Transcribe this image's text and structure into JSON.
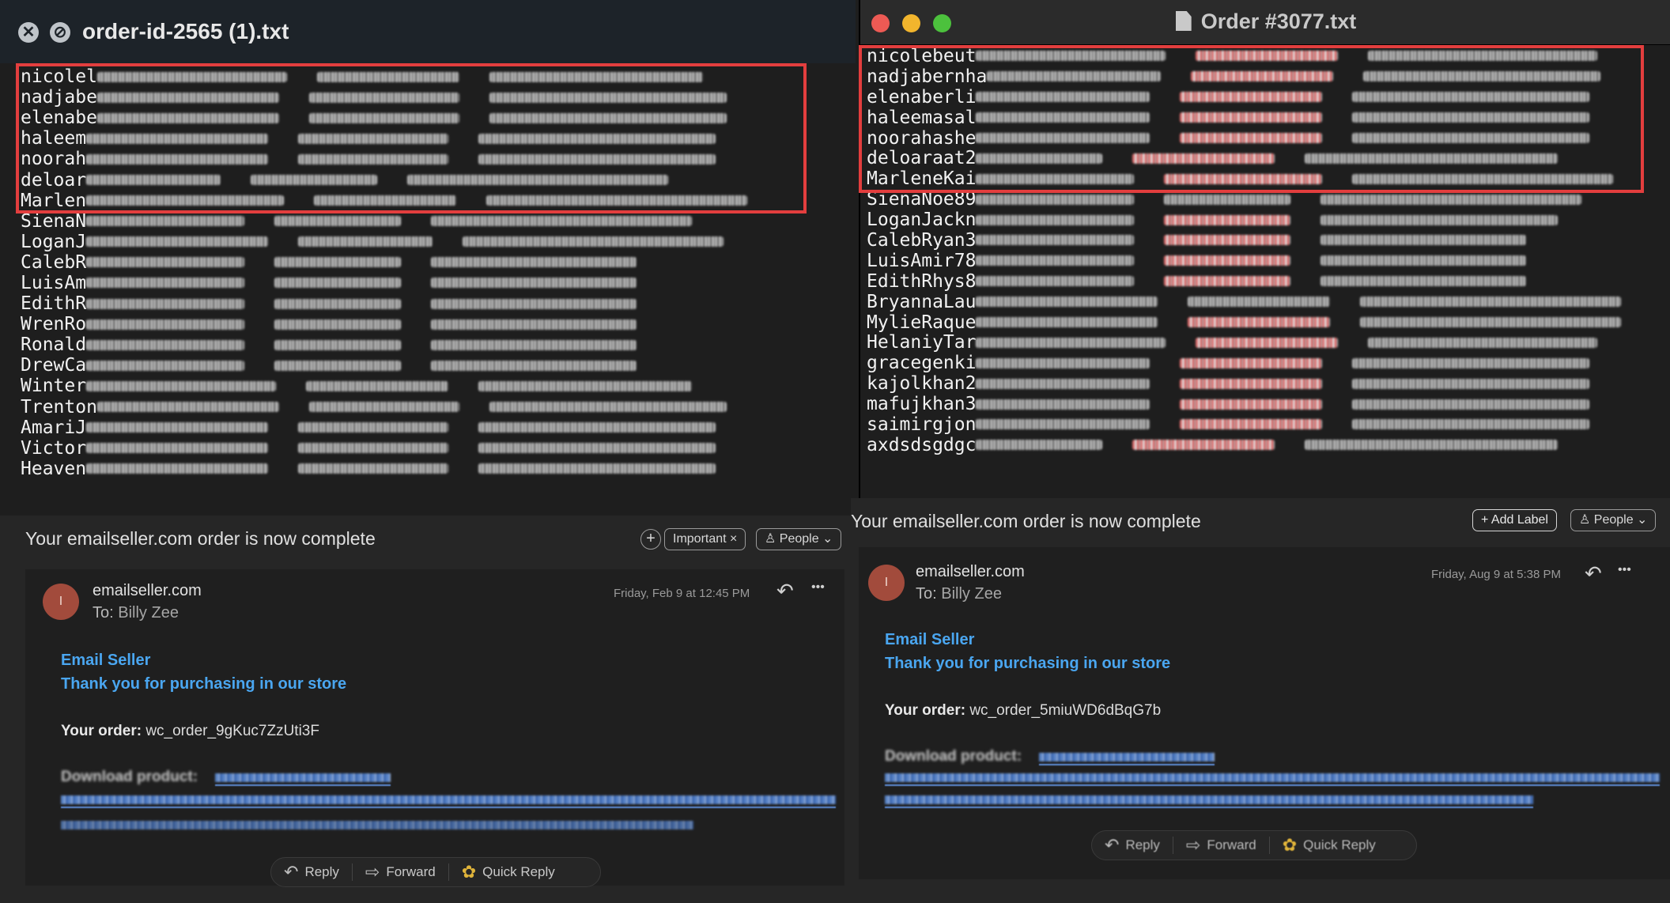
{
  "left_window": {
    "title": "order-id-2565 (1).txt",
    "close_icon": "✕",
    "block_icon": "⊘",
    "lines": [
      "nicolel",
      "nadjabe",
      "elenabe",
      "haleem",
      "noorah",
      "deloar",
      "Marlen",
      "SienaN",
      "LoganJ",
      "CalebR",
      "LuisAm",
      "EdithR",
      "WrenRo",
      "Ronald",
      "DrewCa",
      "Winter",
      "Trenton",
      "AmariJ",
      "Victor",
      "Heaven"
    ]
  },
  "right_window": {
    "title": "Order #3077.txt",
    "lines": [
      "nicolebeut",
      "nadjabernha",
      "elenaberli",
      "haleemasal",
      "noorahashe",
      "deloaraat2",
      "MarleneKai",
      "SienaNoe89",
      "LoganJackn",
      "CalebRyan3",
      "LuisAmir78",
      "EdithRhys8",
      "BryannaLau",
      "MylieRaque",
      "HelaniyTar",
      "gracegenki",
      "kajolkhan2",
      "mafujkhan3",
      "saimirgjon",
      "axdsdsgdgc"
    ]
  },
  "left_email": {
    "subject": "Your emailseller.com order is now complete",
    "add_icon": "+",
    "label_chip": "Important ×",
    "people_chip": "♙ People ⌄",
    "avatar_initial": "I",
    "sender": "emailseller.com",
    "to_prefix": "To: ",
    "to_name": "Billy Zee",
    "date": "Friday, Feb 9 at 12:45 PM",
    "reply_icon": "↶",
    "more_icon": "•••",
    "heading1": "Email Seller",
    "heading2": "Thank you for purchasing in our store",
    "order_label": "Your order:",
    "order_value": "wc_order_9gKuc7ZzUti3F",
    "download_label": "Download product:",
    "reply_bar": {
      "reply": "Reply",
      "forward": "Forward",
      "quick_reply": "Quick Reply"
    }
  },
  "right_email": {
    "subject": "Your emailseller.com order is now complete",
    "add_label_chip": "+ Add Label",
    "people_chip": "♙ People ⌄",
    "avatar_initial": "I",
    "sender": "emailseller.com",
    "to_prefix": "To: ",
    "to_name": "Billy Zee",
    "date": "Friday, Aug 9 at 5:38 PM",
    "reply_icon": "↶",
    "more_icon": "•••",
    "heading1": "Email Seller",
    "heading2": "Thank you for purchasing in our store",
    "order_label": "Your order:",
    "order_value": "wc_order_5miuWD6dBqG7b",
    "download_label": "Download product:",
    "reply_bar": {
      "reply": "Reply",
      "forward": "Forward",
      "quick_reply": "Quick Reply"
    }
  },
  "colors": {
    "highlight": "#e33e3e",
    "link_blue": "#4aa6f0",
    "avatar": "#a24b3c"
  }
}
